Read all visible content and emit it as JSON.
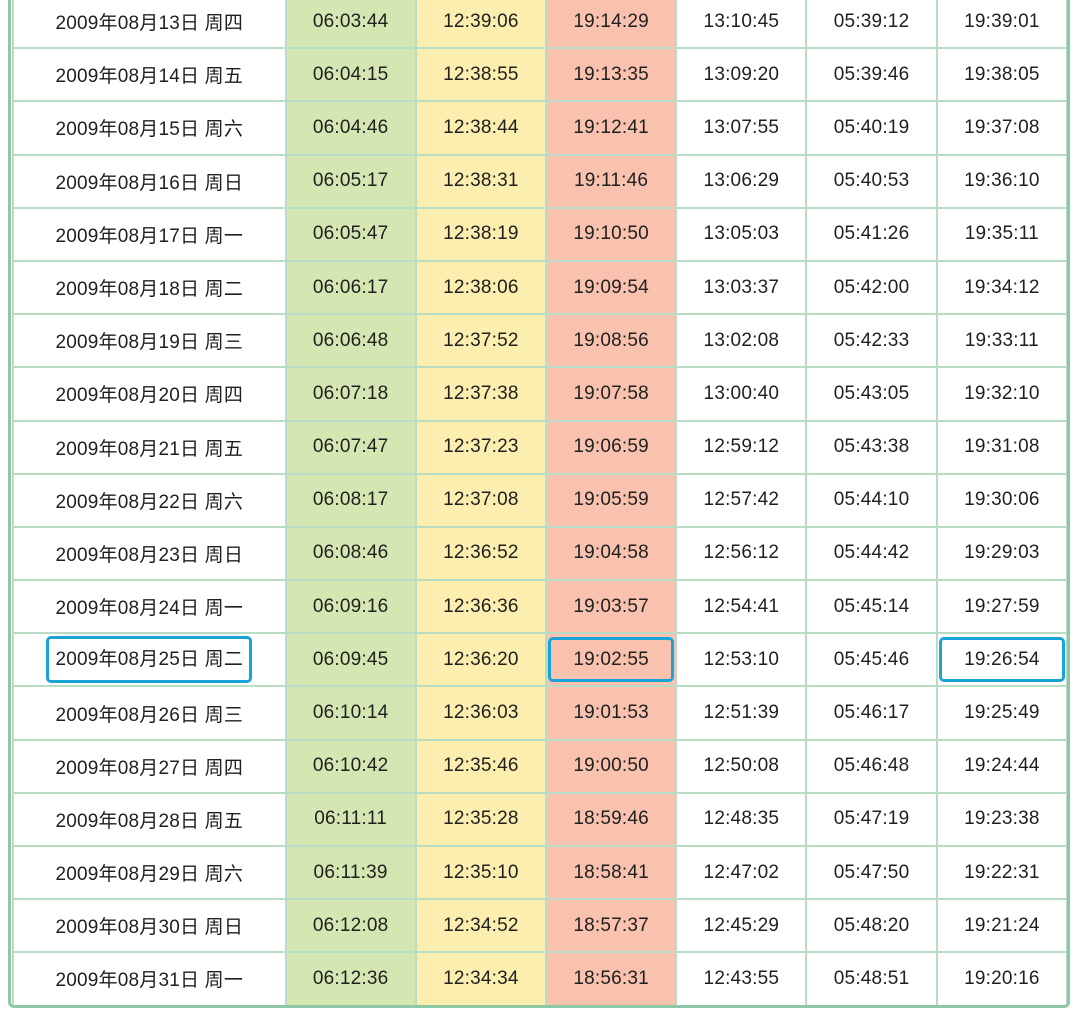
{
  "table": {
    "rows": [
      {
        "date": "2009年08月13日 周四",
        "t1": "06:03:44",
        "t2": "12:39:06",
        "t3": "19:14:29",
        "t4": "13:10:45",
        "t5": "05:39:12",
        "t6": "19:39:01"
      },
      {
        "date": "2009年08月14日 周五",
        "t1": "06:04:15",
        "t2": "12:38:55",
        "t3": "19:13:35",
        "t4": "13:09:20",
        "t5": "05:39:46",
        "t6": "19:38:05"
      },
      {
        "date": "2009年08月15日 周六",
        "t1": "06:04:46",
        "t2": "12:38:44",
        "t3": "19:12:41",
        "t4": "13:07:55",
        "t5": "05:40:19",
        "t6": "19:37:08"
      },
      {
        "date": "2009年08月16日 周日",
        "t1": "06:05:17",
        "t2": "12:38:31",
        "t3": "19:11:46",
        "t4": "13:06:29",
        "t5": "05:40:53",
        "t6": "19:36:10"
      },
      {
        "date": "2009年08月17日 周一",
        "t1": "06:05:47",
        "t2": "12:38:19",
        "t3": "19:10:50",
        "t4": "13:05:03",
        "t5": "05:41:26",
        "t6": "19:35:11"
      },
      {
        "date": "2009年08月18日 周二",
        "t1": "06:06:17",
        "t2": "12:38:06",
        "t3": "19:09:54",
        "t4": "13:03:37",
        "t5": "05:42:00",
        "t6": "19:34:12"
      },
      {
        "date": "2009年08月19日 周三",
        "t1": "06:06:48",
        "t2": "12:37:52",
        "t3": "19:08:56",
        "t4": "13:02:08",
        "t5": "05:42:33",
        "t6": "19:33:11"
      },
      {
        "date": "2009年08月20日 周四",
        "t1": "06:07:18",
        "t2": "12:37:38",
        "t3": "19:07:58",
        "t4": "13:00:40",
        "t5": "05:43:05",
        "t6": "19:32:10"
      },
      {
        "date": "2009年08月21日 周五",
        "t1": "06:07:47",
        "t2": "12:37:23",
        "t3": "19:06:59",
        "t4": "12:59:12",
        "t5": "05:43:38",
        "t6": "19:31:08"
      },
      {
        "date": "2009年08月22日 周六",
        "t1": "06:08:17",
        "t2": "12:37:08",
        "t3": "19:05:59",
        "t4": "12:57:42",
        "t5": "05:44:10",
        "t6": "19:30:06"
      },
      {
        "date": "2009年08月23日 周日",
        "t1": "06:08:46",
        "t2": "12:36:52",
        "t3": "19:04:58",
        "t4": "12:56:12",
        "t5": "05:44:42",
        "t6": "19:29:03"
      },
      {
        "date": "2009年08月24日 周一",
        "t1": "06:09:16",
        "t2": "12:36:36",
        "t3": "19:03:57",
        "t4": "12:54:41",
        "t5": "05:45:14",
        "t6": "19:27:59"
      },
      {
        "date": "2009年08月25日 周二",
        "t1": "06:09:45",
        "t2": "12:36:20",
        "t3": "19:02:55",
        "t4": "12:53:10",
        "t5": "05:45:46",
        "t6": "19:26:54"
      },
      {
        "date": "2009年08月26日 周三",
        "t1": "06:10:14",
        "t2": "12:36:03",
        "t3": "19:01:53",
        "t4": "12:51:39",
        "t5": "05:46:17",
        "t6": "19:25:49"
      },
      {
        "date": "2009年08月27日 周四",
        "t1": "06:10:42",
        "t2": "12:35:46",
        "t3": "19:00:50",
        "t4": "12:50:08",
        "t5": "05:46:48",
        "t6": "19:24:44"
      },
      {
        "date": "2009年08月28日 周五",
        "t1": "06:11:11",
        "t2": "12:35:28",
        "t3": "18:59:46",
        "t4": "12:48:35",
        "t5": "05:47:19",
        "t6": "19:23:38"
      },
      {
        "date": "2009年08月29日 周六",
        "t1": "06:11:39",
        "t2": "12:35:10",
        "t3": "18:58:41",
        "t4": "12:47:02",
        "t5": "05:47:50",
        "t6": "19:22:31"
      },
      {
        "date": "2009年08月30日 周日",
        "t1": "06:12:08",
        "t2": "12:34:52",
        "t3": "18:57:37",
        "t4": "12:45:29",
        "t5": "05:48:20",
        "t6": "19:21:24"
      },
      {
        "date": "2009年08月31日 周一",
        "t1": "06:12:36",
        "t2": "12:34:34",
        "t3": "18:56:31",
        "t4": "12:43:55",
        "t5": "05:48:51",
        "t6": "19:20:16"
      }
    ],
    "highlighted": {
      "row": 12,
      "cells": [
        "date",
        "t3",
        "t6"
      ]
    }
  },
  "colors": {
    "sunrise_column": "#d4e6b2",
    "noon_column": "#fbeeae",
    "sunset_column": "#f9c2ae",
    "grid_line": "#b9dcc4",
    "frame_border": "#8fc8a6",
    "highlight_border": "#1aa3d9"
  }
}
